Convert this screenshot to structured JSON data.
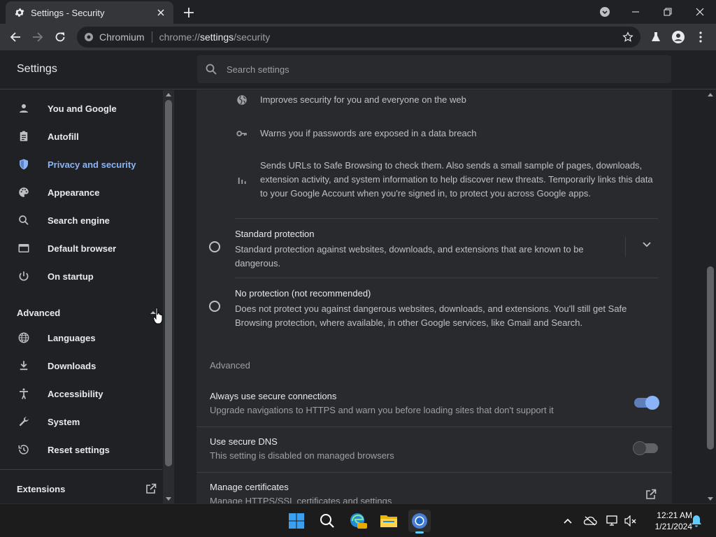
{
  "tab": {
    "title": "Settings - Security"
  },
  "omnibox": {
    "site_label": "Chromium",
    "url_scheme": "chrome://",
    "url_host": "settings",
    "url_path": "/security"
  },
  "header": {
    "title": "Settings",
    "search_placeholder": "Search settings"
  },
  "sidebar": {
    "items": [
      {
        "label": "You and Google"
      },
      {
        "label": "Autofill"
      },
      {
        "label": "Privacy and security"
      },
      {
        "label": "Appearance"
      },
      {
        "label": "Search engine"
      },
      {
        "label": "Default browser"
      },
      {
        "label": "On startup"
      }
    ],
    "advanced_label": "Advanced",
    "advanced_items": [
      {
        "label": "Languages"
      },
      {
        "label": "Downloads"
      },
      {
        "label": "Accessibility"
      },
      {
        "label": "System"
      },
      {
        "label": "Reset settings"
      }
    ],
    "extensions_label": "Extensions"
  },
  "main": {
    "features": [
      {
        "text": "Improves security for you and everyone on the web",
        "icon": "globe-icon"
      },
      {
        "text": "Warns you if passwords are exposed in a data breach",
        "icon": "key-icon"
      },
      {
        "text_lines": [
          "Sends URLs to Safe Browsing to check them. Also sends a small sample of pages, downloads,",
          "extension activity, and system information to help discover new threats. Temporarily links this data",
          "to your Google Account when you're signed in, to protect you across Google apps."
        ],
        "icon": "bar-chart-icon"
      }
    ],
    "standard": {
      "title": "Standard protection",
      "desc_lines": [
        "Standard protection against websites, downloads, and extensions that are known to be",
        "dangerous."
      ]
    },
    "none": {
      "title": "No protection (not recommended)",
      "desc_lines": [
        "Does not protect you against dangerous websites, downloads, and extensions. You'll still get Safe",
        "Browsing protection, where available, in other Google services, like Gmail and Search."
      ]
    },
    "advanced_label": "Advanced",
    "https": {
      "title": "Always use secure connections",
      "desc": "Upgrade navigations to HTTPS and warn you before loading sites that don't support it",
      "enabled": true
    },
    "dns": {
      "title": "Use secure DNS",
      "desc": "This setting is disabled on managed browsers",
      "enabled": false
    },
    "certs": {
      "title": "Manage certificates",
      "desc": "Manage HTTPS/SSL certificates and settings"
    }
  },
  "taskbar": {
    "time": "12:21 AM",
    "date": "1/21/2024"
  },
  "colors": {
    "accent": "#8ab4f8",
    "background": "#202124",
    "card": "#292a2d"
  }
}
